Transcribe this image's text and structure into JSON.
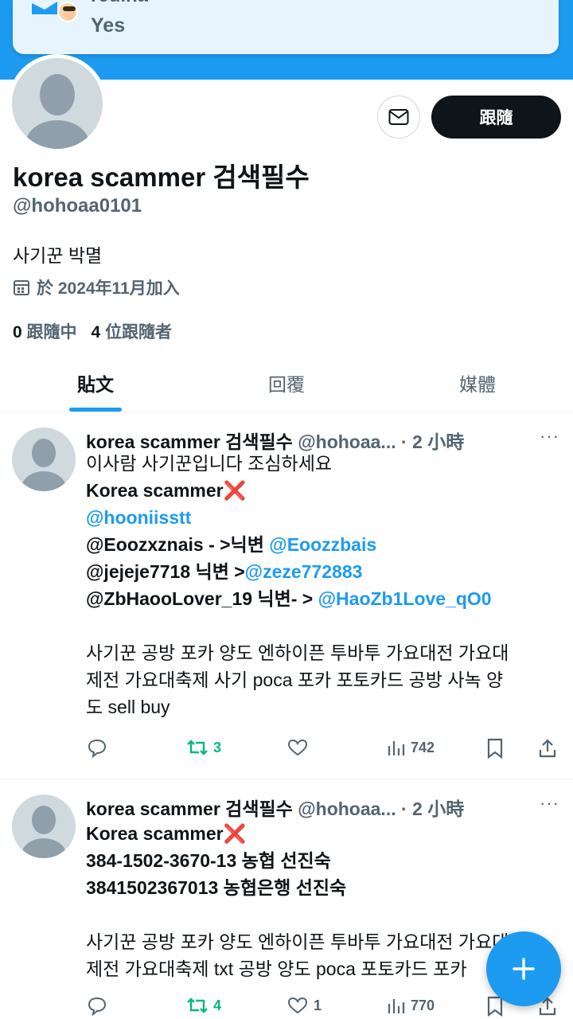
{
  "toast": {
    "name": "regina",
    "text": "Yes"
  },
  "profile": {
    "display_name": "korea scammer 검색필수",
    "handle": "@hohoaa0101",
    "bio": "사기꾼 박멸",
    "joined": "於 2024年11月加入",
    "following_count": "0",
    "following_label": "跟隨中",
    "followers_count": "4",
    "followers_label": "位跟隨者",
    "follow_label": "跟隨"
  },
  "tabs": [
    {
      "label": "貼文",
      "active": true
    },
    {
      "label": "回覆",
      "active": false
    },
    {
      "label": "媒體",
      "active": false
    }
  ],
  "posts": [
    {
      "name": "korea scammer 검색필수",
      "meta": "@hohoaa... · 2 小時",
      "lines": {
        "l1": "이사람 사기꾼입니다 조심하세요",
        "l2": "Korea scammer",
        "l3": "@hooniisstt",
        "l4a": "@Eoozxznais - >닉변 ",
        "l4b": "@Eoozzbais",
        "l5a": "@jejeje7718 닉변 >",
        "l5b": "@zeze772883",
        "l6a": "@ZbHaooLover_19 닉변- > ",
        "l6b": "@HaoZb1Love_qO0",
        "l7": "사기꾼 공방 포카 양도 엔하이픈 투바투 가요대전 가요대",
        "l8": "제전 가요대축제 사기 poca 포카 포토카드 공방 사녹  양",
        "l9": "도 sell buy"
      },
      "retweets": "3",
      "likes": "",
      "views": "742"
    },
    {
      "name": "korea scammer 검색필수",
      "meta": "@hohoaa... · 2 小時",
      "lines": {
        "l1": "Korea scammer",
        "l2": "384-1502-3670-13 농협 선진숙",
        "l3": "3841502367013 농협은행 선진숙",
        "l4": "사기꾼 공방 포카 양도 엔하이픈 투바투 가요대전 가요대",
        "l5": "제전 가요대축제 txt 공방 양도 poca 포토카드 포카"
      },
      "retweets": "4",
      "likes": "1",
      "views": "770"
    }
  ],
  "colors": {
    "accent": "#1d9bf0",
    "retweet": "#00ba7c",
    "scam_mark": "#e0245e"
  }
}
